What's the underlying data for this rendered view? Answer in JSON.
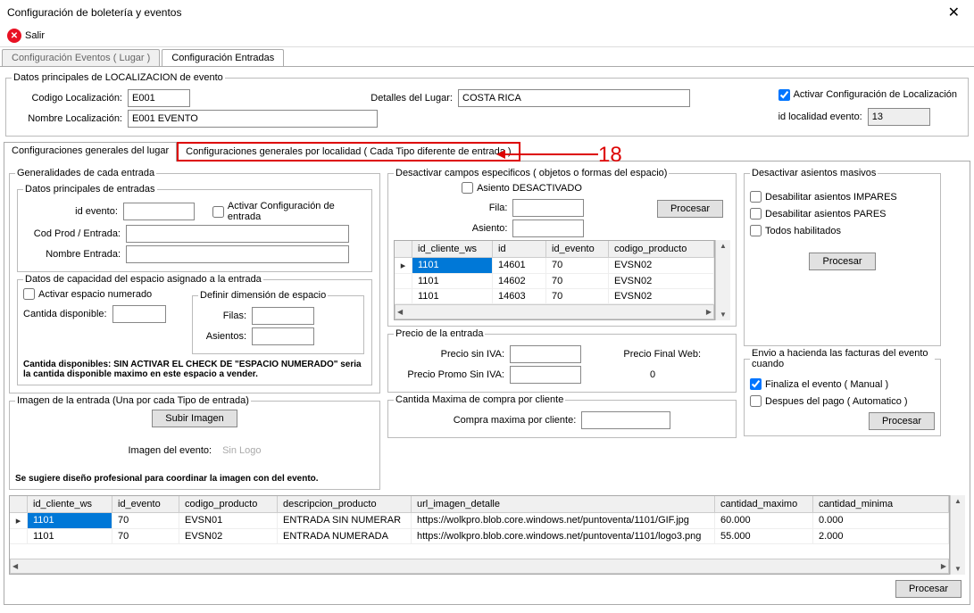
{
  "window": {
    "title": "Configuración de boletería y eventos"
  },
  "toolbar": {
    "salir": "Salir"
  },
  "main_tabs": {
    "t1": "Configuración Eventos ( Lugar )",
    "t2": "Configuración Entradas"
  },
  "loc_group": {
    "legend": "Datos principales de LOCALIZACION de evento",
    "codigo_label": "Codigo Localización:",
    "codigo_val": "E001",
    "nombre_label": "Nombre Localización:",
    "nombre_val": "E001 EVENTO",
    "detalles_label": "Detalles del Lugar:",
    "detalles_val": "COSTA RICA",
    "activar_label": "Activar Configuración de Localización",
    "id_loc_label": "id localidad evento:",
    "id_loc_val": "13"
  },
  "sub_tabs": {
    "t1": "Configuraciones generales del lugar",
    "t2": "Configuraciones generales por localidad ( Cada Tipo diferente de entrada )"
  },
  "annotation": {
    "num": "18"
  },
  "gen_entrada": {
    "legend": "Generalidades de cada entrada",
    "datos_legend": "Datos principales de entradas",
    "id_evento_label": "id evento:",
    "activar_entrada_label": "Activar Configuración de entrada",
    "cod_prod_label": "Cod Prod / Entrada:",
    "nombre_entrada_label": "Nombre Entrada:",
    "cap_legend": "Datos de capacidad del espacio asignado a la entrada",
    "activar_espacio_label": "Activar espacio numerado",
    "cantida_disp_label": "Cantida disponible:",
    "definir_legend": "Definir dimensión de espacio",
    "filas_label": "Filas:",
    "asientos_label": "Asientos:",
    "nota": "Cantida disponibles: SIN ACTIVAR EL CHECK DE \"ESPACIO NUMERADO\" seria la cantida disponible maximo en este espacio  a vender."
  },
  "img_entrada": {
    "legend": "Imagen de la entrada (Una por cada Tipo de entrada)",
    "subir_btn": "Subir Imagen",
    "imagen_evento_label": "Imagen del evento:",
    "sin_logo": "Sin Logo",
    "nota": "Se sugiere diseño profesional para coordinar la imagen con del evento."
  },
  "desact_campos": {
    "legend": "Desactivar campos especificos ( objetos o formas del espacio)",
    "asiento_desact": "Asiento DESACTIVADO",
    "fila_label": "Fila:",
    "asiento_label": "Asiento:",
    "procesar": "Procesar",
    "grid": {
      "headers": [
        "id_cliente_ws",
        "id",
        "id_evento",
        "codigo_producto"
      ],
      "rows": [
        [
          "1101",
          "14601",
          "70",
          "EVSN02"
        ],
        [
          "1101",
          "14602",
          "70",
          "EVSN02"
        ],
        [
          "1101",
          "14603",
          "70",
          "EVSN02"
        ]
      ]
    }
  },
  "precio": {
    "legend": "Precio de la entrada",
    "sin_iva_label": "Precio sin IVA:",
    "final_web_label": "Precio Final Web:",
    "promo_label": "Precio Promo Sin IVA:",
    "final_val": "0"
  },
  "cant_max": {
    "legend": "Cantida Maxima de compra por cliente",
    "label": "Compra maxima por cliente:"
  },
  "desact_masivos": {
    "legend": "Desactivar asientos masivos",
    "impares": "Desabilitar asientos IMPARES",
    "pares": "Desabilitar asientos PARES",
    "todos": "Todos habilitados",
    "procesar": "Procesar"
  },
  "envio_hacienda": {
    "legend": "Envio a hacienda las facturas del evento cuando",
    "finaliza": "Finaliza el evento ( Manual )",
    "despues": "Despues del pago ( Automatico )",
    "procesar": "Procesar"
  },
  "bottom_grid": {
    "headers": [
      "id_cliente_ws",
      "id_evento",
      "codigo_producto",
      "descripcion_producto",
      "url_imagen_detalle",
      "cantidad_maximo",
      "cantidad_minima"
    ],
    "rows": [
      [
        "1101",
        "70",
        "EVSN01",
        "ENTRADA SIN NUMERAR",
        "https://wolkpro.blob.core.windows.net/puntoventa/1101/GIF.jpg",
        "60.000",
        "0.000"
      ],
      [
        "1101",
        "70",
        "EVSN02",
        "ENTRADA NUMERADA",
        "https://wolkpro.blob.core.windows.net/puntoventa/1101/logo3.png",
        "55.000",
        "2.000"
      ]
    ],
    "procesar": "Procesar"
  }
}
